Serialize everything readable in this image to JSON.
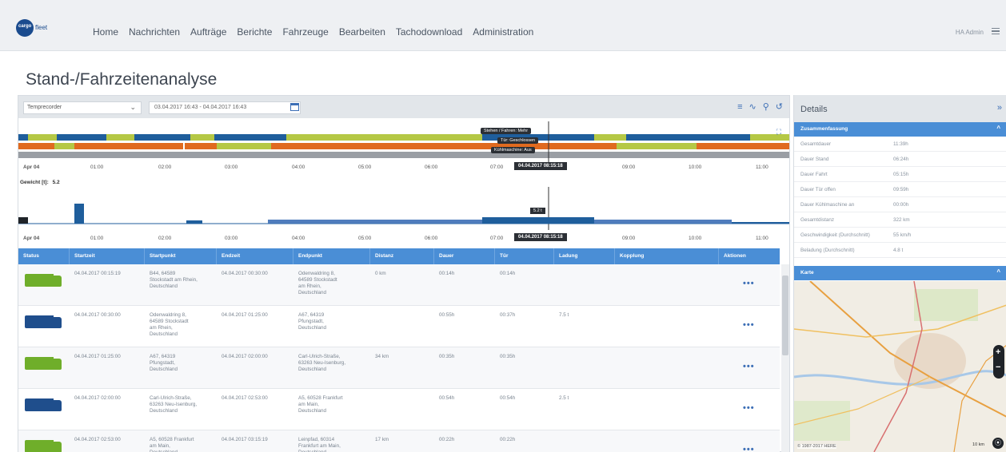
{
  "app": {
    "logo_text": "cargo",
    "logo_suffix": "fleet",
    "user": "HA Admin"
  },
  "nav": [
    "Home",
    "Nachrichten",
    "Aufträge",
    "Berichte",
    "Fahrzeuge",
    "Bearbeiten",
    "Tachodownload",
    "Administration"
  ],
  "page_title": "Stand-/Fahrzeitenanalyse",
  "toolbar": {
    "select_value": "Temprecorder",
    "daterange": "03.04.2017 16:43 - 04.04.2017 16:43"
  },
  "gantt": {
    "tooltips": [
      "Stehen / Fahren: Mehr",
      "Tür: Geschlossen",
      "Kühlmaschine: Aus"
    ],
    "time_marker": "04.04.2017 08:15:18",
    "ticks": [
      "Apr 04",
      "01:00",
      "02:00",
      "03:00",
      "04:00",
      "05:00",
      "06:00",
      "07:00",
      "08:00",
      "09:00",
      "10:00",
      "11:00"
    ],
    "weight_label": "Gewicht [t]:",
    "weight_value": "5.2",
    "weight_marker": "5.2 t",
    "colors": {
      "blue": "#1f5e9c",
      "green": "#b5c845",
      "orange": "#e06a1f",
      "gray": "#9a9ea4"
    }
  },
  "table": {
    "headers": [
      "Status",
      "Startzeit",
      "Startpunkt",
      "Endzeit",
      "Endpunkt",
      "Distanz",
      "Dauer",
      "Tür",
      "Ladung",
      "Kopplung",
      "Aktionen"
    ],
    "rows": [
      {
        "status": "green",
        "start": "04.04.2017 00:15:19",
        "start_loc": [
          "B44, 64589",
          "Stockstadt am Rhein,",
          "Deutschland"
        ],
        "end": "04.04.2017 00:30:00",
        "end_loc": [
          "Odenwaldring 8,",
          "64589 Stockstadt",
          "am Rhein,",
          "Deutschland"
        ],
        "dist": "0 km",
        "dur": "00:14h",
        "door": "00:14h",
        "load": ""
      },
      {
        "status": "blue",
        "start": "04.04.2017 00:30:00",
        "start_loc": [
          "Odenwaldring 8,",
          "64589 Stockstadt",
          "am Rhein,",
          "Deutschland"
        ],
        "end": "04.04.2017 01:25:00",
        "end_loc": [
          "A67, 64319",
          "Pfungstadt,",
          "Deutschland"
        ],
        "dist": "",
        "dur": "00:55h",
        "door": "00:37h",
        "load": "7.5 t"
      },
      {
        "status": "green",
        "start": "04.04.2017 01:25:00",
        "start_loc": [
          "A67, 64319",
          "Pfungstadt,",
          "Deutschland"
        ],
        "end": "04.04.2017 02:00:00",
        "end_loc": [
          "Carl-Ulrich-Straße,",
          "63263 Neu-Isenburg,",
          "Deutschland"
        ],
        "dist": "34 km",
        "dur": "00:35h",
        "door": "00:35h",
        "load": ""
      },
      {
        "status": "blue",
        "start": "04.04.2017 02:00:00",
        "start_loc": [
          "Carl-Ulrich-Straße,",
          "63263 Neu-Isenburg,",
          "Deutschland"
        ],
        "end": "04.04.2017 02:53:00",
        "end_loc": [
          "A5, 60528 Frankfurt",
          "am Main,",
          "Deutschland"
        ],
        "dist": "",
        "dur": "00:54h",
        "door": "00:54h",
        "load": "2.5 t"
      },
      {
        "status": "green",
        "start": "04.04.2017 02:53:00",
        "start_loc": [
          "A5, 60528 Frankfurt",
          "am Main,",
          "Deutschland"
        ],
        "end": "04.04.2017 03:15:19",
        "end_loc": [
          "Leinpfad, 60314",
          "Frankfurt am Main,",
          "Deutschland"
        ],
        "dist": "17 km",
        "dur": "00:22h",
        "door": "00:22h",
        "load": ""
      }
    ]
  },
  "details": {
    "title": "Details",
    "summary_title": "Zusammenfassung",
    "rows": [
      {
        "k": "Gesamtdauer",
        "v": "11:39h"
      },
      {
        "k": "Dauer Stand",
        "v": "06:24h"
      },
      {
        "k": "Dauer Fahrt",
        "v": "05:15h"
      },
      {
        "k": "Dauer Tür offen",
        "v": "09:59h"
      },
      {
        "k": "Dauer Kühlmaschine an",
        "v": "00:00h"
      },
      {
        "k": "Gesamtdistanz",
        "v": "322 km"
      },
      {
        "k": "Geschwindigkeit (Durchschnitt)",
        "v": "55 km/h"
      },
      {
        "k": "Beladung (Durchschnitt)",
        "v": "4.8 t"
      }
    ],
    "map_title": "Karte",
    "map_copyright": "© 1987-2017 HERE",
    "map_scale": "10 km"
  }
}
